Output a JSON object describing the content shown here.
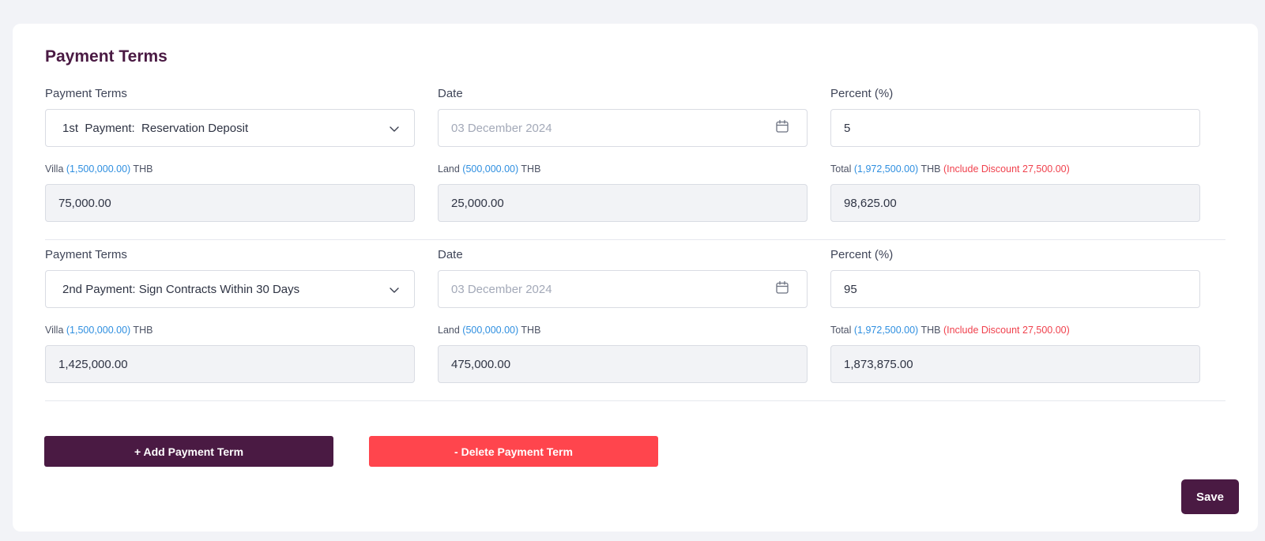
{
  "section": {
    "title": "Payment Terms"
  },
  "terms": [
    {
      "payment_terms_label": "Payment Terms",
      "payment_terms_value": "1st  Payment:  Reservation Deposit",
      "date_label": "Date",
      "date_value": "03 December 2024",
      "percent_label": "Percent (%)",
      "percent_value": "5",
      "villa": {
        "prefix": "Villa ",
        "amount": "(1,500,000.00)",
        "suffix": " THB",
        "value": "75,000.00"
      },
      "land": {
        "prefix": "Land ",
        "amount": "(500,000.00)",
        "suffix": " THB",
        "value": "25,000.00"
      },
      "total": {
        "prefix": "Total ",
        "amount": "(1,972,500.00)",
        "suffix": " THB ",
        "discount": "(Include Discount 27,500.00)",
        "value": "98,625.00"
      }
    },
    {
      "payment_terms_label": "Payment Terms",
      "payment_terms_value": "2nd Payment: Sign Contracts Within 30 Days",
      "date_label": "Date",
      "date_value": "03 December 2024",
      "percent_label": "Percent (%)",
      "percent_value": "95",
      "villa": {
        "prefix": "Villa ",
        "amount": "(1,500,000.00)",
        "suffix": " THB",
        "value": "1,425,000.00"
      },
      "land": {
        "prefix": "Land ",
        "amount": "(500,000.00)",
        "suffix": " THB",
        "value": "475,000.00"
      },
      "total": {
        "prefix": "Total ",
        "amount": "(1,972,500.00)",
        "suffix": " THB ",
        "discount": "(Include Discount 27,500.00)",
        "value": "1,873,875.00"
      }
    }
  ],
  "actions": {
    "add_label": "+ Add Payment Term",
    "delete_label": "- Delete Payment Term",
    "save_label": "Save"
  },
  "icons": {
    "select": "chevron-down-icon",
    "date": "calendar-icon"
  },
  "colors": {
    "brand": "#4a1a43",
    "danger": "#ff454d",
    "link_blue": "#2f8fe0",
    "discount_red": "#f0414d"
  }
}
